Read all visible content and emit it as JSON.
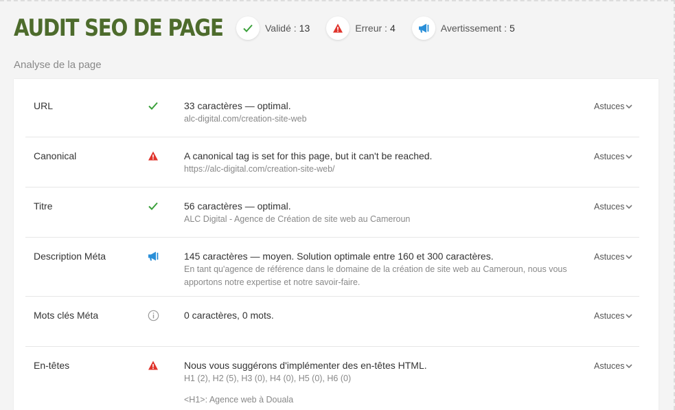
{
  "header": {
    "title": "AUDIT SEO DE PAGE",
    "stats": [
      {
        "icon": "check-icon",
        "label": "Validé :",
        "value": "13"
      },
      {
        "icon": "warning-icon",
        "label": "Erreur :",
        "value": "4"
      },
      {
        "icon": "megaphone-icon",
        "label": "Avertissement :",
        "value": "5"
      }
    ]
  },
  "section": {
    "title": "Analyse de la page"
  },
  "colors": {
    "title": "#4d6b2c",
    "success": "#3aa03a",
    "error": "#e0342c",
    "warning": "#2a8fd8",
    "info": "#999999"
  },
  "rows": [
    {
      "label": "URL",
      "status": "check-icon",
      "main": "33 caractères — optimal.",
      "sub": "alc-digital.com/creation-site-web",
      "sub2": "",
      "tips": "Astuces"
    },
    {
      "label": "Canonical",
      "status": "warning-icon",
      "main": "A canonical tag is set for this page, but it can't be reached.",
      "sub": "https://alc-digital.com/creation-site-web/",
      "sub2": "",
      "tips": "Astuces"
    },
    {
      "label": "Titre",
      "status": "check-icon",
      "main": "56 caractères — optimal.",
      "sub": "ALC Digital - Agence de Création de site web au Cameroun",
      "sub2": "",
      "tips": "Astuces"
    },
    {
      "label": "Description Méta",
      "status": "megaphone-icon",
      "main": "145 caractères — moyen. Solution optimale entre 160 et 300 caractères.",
      "sub": "En tant qu'agence de référence dans le domaine de la création de site web au Cameroun, nous vous",
      "sub2": "apportons notre expertise et notre savoir-faire.",
      "tips": "Astuces"
    },
    {
      "label": "Mots clés Méta",
      "status": "info-icon",
      "main": "0 caractères, 0 mots.",
      "sub": "",
      "sub2": "",
      "tips": "Astuces"
    },
    {
      "label": "En-têtes",
      "status": "warning-icon",
      "main": "Nous vous suggérons d'implémenter des en-têtes HTML.",
      "sub": "H1 (2), H2 (5), H3 (0), H4 (0), H5 (0), H6 (0)",
      "sub2": "<H1>: Agence web à Douala",
      "tips": "Astuces"
    }
  ]
}
